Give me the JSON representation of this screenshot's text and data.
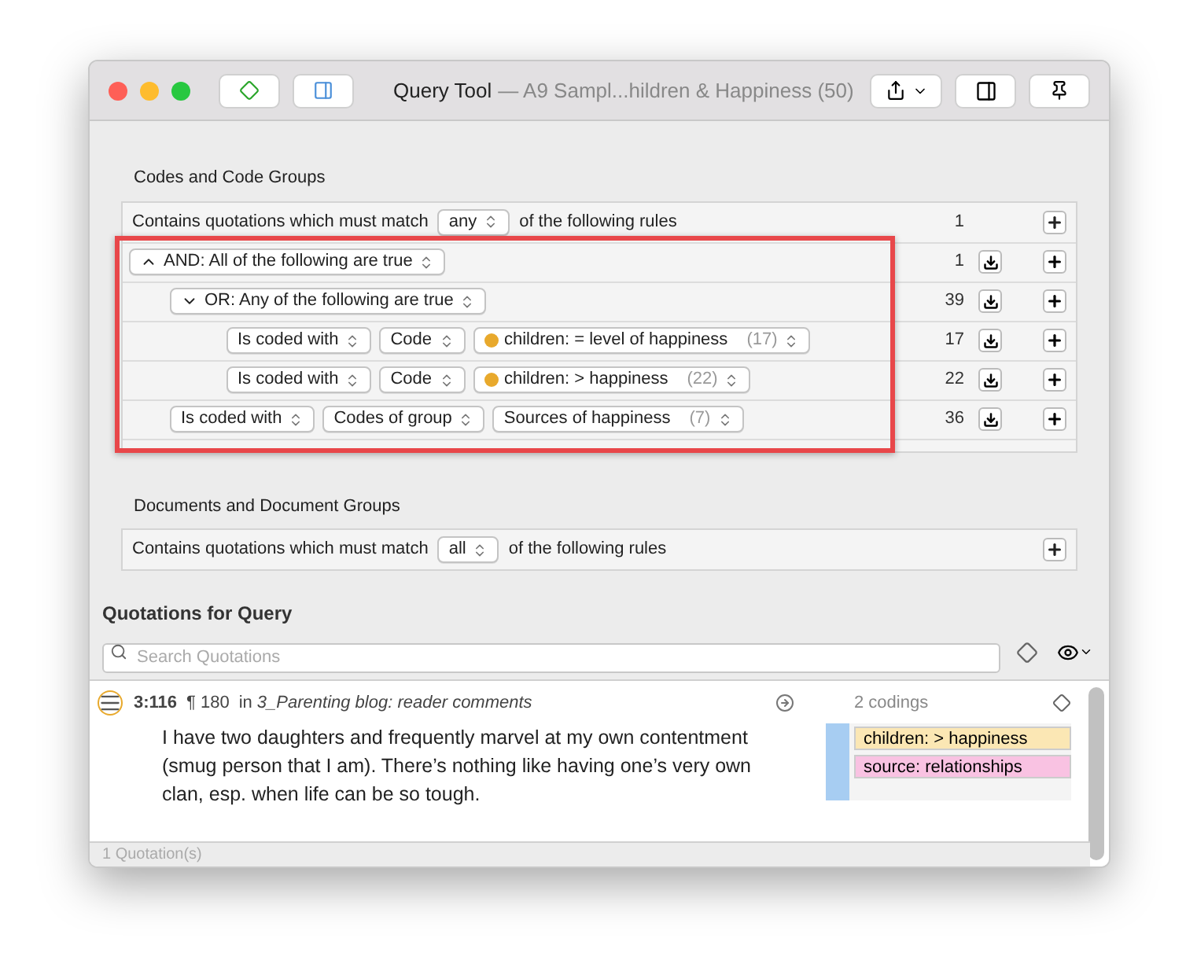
{
  "window": {
    "title": "Query Tool",
    "subtitle": "— A9 Sampl...hildren & Happiness (50)"
  },
  "codes_section": {
    "title": "Codes and Code Groups",
    "match": {
      "prefix": "Contains quotations which must match",
      "value": "any",
      "suffix": "of the following rules",
      "count": "1"
    },
    "rules": [
      {
        "kind": "group",
        "label": "AND: All of the following are true",
        "count": "1",
        "children": [
          {
            "kind": "group",
            "label": "OR: Any of the following are true",
            "count": "39",
            "children": [
              {
                "kind": "condition",
                "count": "17",
                "parts": [
                  {
                    "text": "Is coded with"
                  },
                  {
                    "text": "Code"
                  },
                  {
                    "text": "children: = level of happiness",
                    "count": "(17)",
                    "color": "#e8a92c"
                  }
                ]
              },
              {
                "kind": "condition",
                "count": "22",
                "parts": [
                  {
                    "text": "Is coded with"
                  },
                  {
                    "text": "Code"
                  },
                  {
                    "text": "children: > happiness",
                    "count": "(22)",
                    "color": "#e8a92c"
                  }
                ]
              }
            ]
          },
          {
            "kind": "condition",
            "count": "36",
            "parts": [
              {
                "text": "Is coded with"
              },
              {
                "text": "Codes of group"
              },
              {
                "text": "Sources of happiness",
                "count": "(7)"
              }
            ]
          }
        ]
      }
    ]
  },
  "documents_section": {
    "title": "Documents and Document Groups",
    "match": {
      "prefix": "Contains quotations which must match",
      "value": "all",
      "suffix": "of the following rules"
    }
  },
  "quotations": {
    "title": "Quotations for Query",
    "search": {
      "placeholder": "Search Quotations"
    },
    "items": [
      {
        "id": "3:116",
        "paragraph": "¶ 180",
        "in": "in",
        "document": "3_Parenting blog: reader comments",
        "text": "I have two daughters and frequently marvel at my own contentment (smug person that I am). There’s nothing like having one’s very own clan, esp. when life can be so tough.",
        "codings": "2 codings",
        "codes": [
          {
            "label": "children: > happiness",
            "color": "#fbe7b4"
          },
          {
            "label": "source: relationships",
            "color": "#f9c2e2"
          }
        ]
      }
    ],
    "footer": "1 Quotation(s)"
  }
}
